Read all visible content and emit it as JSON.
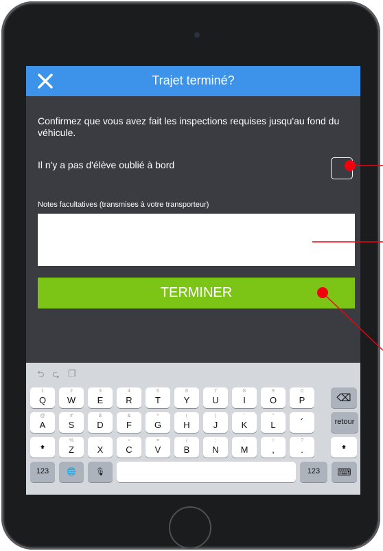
{
  "header": {
    "title": "Trajet terminé?",
    "close_icon": "close-icon"
  },
  "main": {
    "confirm_text": "Confirmez que vous avez fait les inspections requises jusqu'au fond du véhicule.",
    "checkbox_label": "Il n'y a pas d'élève oublié à bord",
    "checkbox_checked": false,
    "notes_label": "Notes facultatives (transmises à votre transporteur)",
    "notes_value": "",
    "submit_label": "TERMINER"
  },
  "keyboard": {
    "toolbar_icons": [
      "undo-icon",
      "redo-icon",
      "paste-icon"
    ],
    "toolbar_glyphs": [
      "⮌",
      "⮎",
      "❐"
    ],
    "row1": [
      {
        "hint": "1",
        "main": "Q"
      },
      {
        "hint": "2",
        "main": "W"
      },
      {
        "hint": "3",
        "main": "E"
      },
      {
        "hint": "4",
        "main": "R"
      },
      {
        "hint": "5",
        "main": "T"
      },
      {
        "hint": "6",
        "main": "Y"
      },
      {
        "hint": "7",
        "main": "U"
      },
      {
        "hint": "8",
        "main": "I"
      },
      {
        "hint": "9",
        "main": "O"
      },
      {
        "hint": "0",
        "main": "P"
      }
    ],
    "backspace_glyph": "⌫",
    "row2": [
      {
        "hint": "@",
        "main": "A"
      },
      {
        "hint": "#",
        "main": "S"
      },
      {
        "hint": "$",
        "main": "D"
      },
      {
        "hint": "&",
        "main": "F"
      },
      {
        "hint": "*",
        "main": "G"
      },
      {
        "hint": "(",
        "main": "H"
      },
      {
        "hint": ")",
        "main": "J"
      },
      {
        "hint": "'",
        "main": "K"
      },
      {
        "hint": "\"",
        "main": "L"
      },
      {
        "hint": "",
        "main": "´"
      }
    ],
    "return_label": "retour",
    "shift_glyph": "🠹",
    "row3": [
      {
        "hint": "%",
        "main": "Z"
      },
      {
        "hint": "-",
        "main": "X"
      },
      {
        "hint": "+",
        "main": "C"
      },
      {
        "hint": "=",
        "main": "V"
      },
      {
        "hint": "/",
        "main": "B"
      },
      {
        "hint": ";",
        "main": "N"
      },
      {
        "hint": ":",
        "main": "M"
      },
      {
        "hint": "!",
        "main": ","
      },
      {
        "hint": "?",
        "main": "."
      }
    ],
    "numbers_label": "123",
    "globe_glyph": "🌐",
    "mic_glyph": "🎙",
    "keyboard_hide_glyph": "⌨"
  },
  "colors": {
    "header_bg": "#3d93ea",
    "submit_bg": "#7cc516",
    "screen_bg": "#3a3c42",
    "annotation": "#f3000d"
  }
}
